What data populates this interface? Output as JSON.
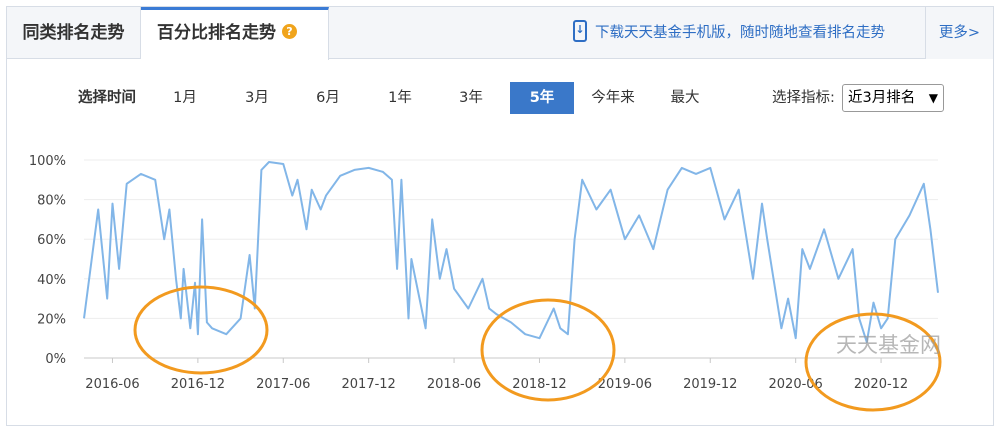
{
  "tabs": [
    {
      "label": "同类排名走势",
      "active": false
    },
    {
      "label": "百分比排名走势",
      "active": true,
      "badge": "?"
    }
  ],
  "download_text": "下载天天基金手机版，随时随地查看排名走势",
  "more_label": "更多>",
  "controls": {
    "time_label": "选择时间",
    "periods": [
      "1月",
      "3月",
      "6月",
      "1年",
      "3年",
      "5年",
      "今年来",
      "最大"
    ],
    "active_period": "5年",
    "indicator_label": "选择指标:",
    "indicator_value": "近3月排名"
  },
  "watermark": "天天基金网",
  "colors": {
    "line": "#82b6e8",
    "highlight": "#f29a1f",
    "active_tab": "#3a78c9"
  },
  "chart_data": {
    "type": "line",
    "title": "",
    "xlabel": "",
    "ylabel": "",
    "ylim": [
      0,
      100
    ],
    "yticks": [
      "100%",
      "80%",
      "60%",
      "40%",
      "20%",
      "0%"
    ],
    "xticks": [
      "2016-06",
      "2016-12",
      "2017-06",
      "2017-12",
      "2018-06",
      "2018-12",
      "2019-06",
      "2019-12",
      "2020-06",
      "2020-12"
    ],
    "xrange": [
      "2016-04",
      "2021-04"
    ],
    "series": [
      {
        "values": [
          [
            "2016-04",
            20
          ],
          [
            "2016-05",
            75
          ],
          [
            "2016-05-20",
            30
          ],
          [
            "2016-06",
            78
          ],
          [
            "2016-06-15",
            45
          ],
          [
            "2016-07",
            88
          ],
          [
            "2016-08",
            93
          ],
          [
            "2016-09",
            90
          ],
          [
            "2016-09-20",
            60
          ],
          [
            "2016-10",
            75
          ],
          [
            "2016-10-15",
            40
          ],
          [
            "2016-10-25",
            20
          ],
          [
            "2016-11",
            45
          ],
          [
            "2016-11-15",
            15
          ],
          [
            "2016-11-25",
            38
          ],
          [
            "2016-12",
            12
          ],
          [
            "2016-12-10",
            70
          ],
          [
            "2016-12-20",
            18
          ],
          [
            "2017-01",
            15
          ],
          [
            "2017-02",
            12
          ],
          [
            "2017-03",
            20
          ],
          [
            "2017-03-20",
            52
          ],
          [
            "2017-04",
            25
          ],
          [
            "2017-04-15",
            95
          ],
          [
            "2017-05",
            99
          ],
          [
            "2017-06",
            98
          ],
          [
            "2017-06-20",
            82
          ],
          [
            "2017-07",
            90
          ],
          [
            "2017-07-20",
            65
          ],
          [
            "2017-08",
            85
          ],
          [
            "2017-08-20",
            75
          ],
          [
            "2017-09",
            82
          ],
          [
            "2017-10",
            92
          ],
          [
            "2017-11",
            95
          ],
          [
            "2017-12",
            96
          ],
          [
            "2018-01",
            94
          ],
          [
            "2018-01-20",
            90
          ],
          [
            "2018-02",
            45
          ],
          [
            "2018-02-10",
            90
          ],
          [
            "2018-02-25",
            20
          ],
          [
            "2018-03",
            50
          ],
          [
            "2018-04",
            15
          ],
          [
            "2018-04-15",
            70
          ],
          [
            "2018-05",
            40
          ],
          [
            "2018-05-15",
            55
          ],
          [
            "2018-06",
            35
          ],
          [
            "2018-07",
            25
          ],
          [
            "2018-08",
            40
          ],
          [
            "2018-08-15",
            25
          ],
          [
            "2018-09",
            22
          ],
          [
            "2018-10",
            18
          ],
          [
            "2018-11",
            12
          ],
          [
            "2018-12",
            10
          ],
          [
            "2019-01",
            25
          ],
          [
            "2019-01-15",
            15
          ],
          [
            "2019-02",
            12
          ],
          [
            "2019-02-15",
            60
          ],
          [
            "2019-03",
            90
          ],
          [
            "2019-04",
            75
          ],
          [
            "2019-05",
            85
          ],
          [
            "2019-06",
            60
          ],
          [
            "2019-07",
            72
          ],
          [
            "2019-08",
            55
          ],
          [
            "2019-09",
            85
          ],
          [
            "2019-10",
            96
          ],
          [
            "2019-11",
            93
          ],
          [
            "2019-12",
            96
          ],
          [
            "2020-01",
            70
          ],
          [
            "2020-02",
            85
          ],
          [
            "2020-03",
            40
          ],
          [
            "2020-03-20",
            78
          ],
          [
            "2020-04",
            60
          ],
          [
            "2020-05",
            15
          ],
          [
            "2020-05-15",
            30
          ],
          [
            "2020-06",
            10
          ],
          [
            "2020-06-15",
            55
          ],
          [
            "2020-07",
            45
          ],
          [
            "2020-08",
            65
          ],
          [
            "2020-09",
            40
          ],
          [
            "2020-10",
            55
          ],
          [
            "2020-10-15",
            20
          ],
          [
            "2020-11",
            8
          ],
          [
            "2020-11-15",
            28
          ],
          [
            "2020-12",
            15
          ],
          [
            "2020-12-15",
            20
          ],
          [
            "2021-01",
            60
          ],
          [
            "2021-02",
            72
          ],
          [
            "2021-03",
            88
          ],
          [
            "2021-03-15",
            65
          ],
          [
            "2021-04",
            33
          ]
        ]
      }
    ]
  }
}
